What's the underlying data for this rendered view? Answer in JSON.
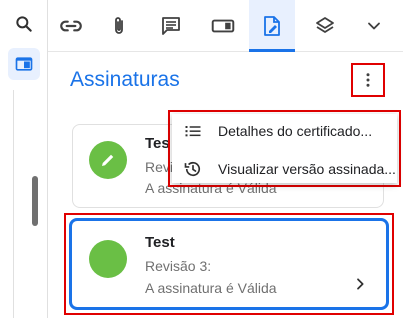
{
  "rail": {
    "icons": [
      "search-icon",
      "side-panel-icon"
    ]
  },
  "toolbar": {
    "icons": [
      "link-icon",
      "attachment-icon",
      "comment-icon",
      "form-field-icon",
      "signature-icon",
      "layers-icon",
      "chevron-down-icon"
    ],
    "active": "signature-icon"
  },
  "panel": {
    "title": "Assinaturas",
    "more_icon": "more-vert-icon"
  },
  "menu": {
    "items": [
      {
        "icon": "list-icon",
        "label": "Detalhes do certificado..."
      },
      {
        "icon": "history-icon",
        "label": "Visualizar versão assinada..."
      }
    ]
  },
  "signatures": [
    {
      "name": "Tes",
      "revision": "Revis",
      "status": "A assinatura é Válida",
      "icon": "pencil-icon"
    },
    {
      "name": "Test",
      "revision": "Revisão 3:",
      "status": "A assinatura é Válida",
      "chevron": "chevron-right-icon"
    }
  ],
  "colors": {
    "accent": "#1a73e8",
    "highlight": "#e00000",
    "valid_green": "#6abf45"
  }
}
